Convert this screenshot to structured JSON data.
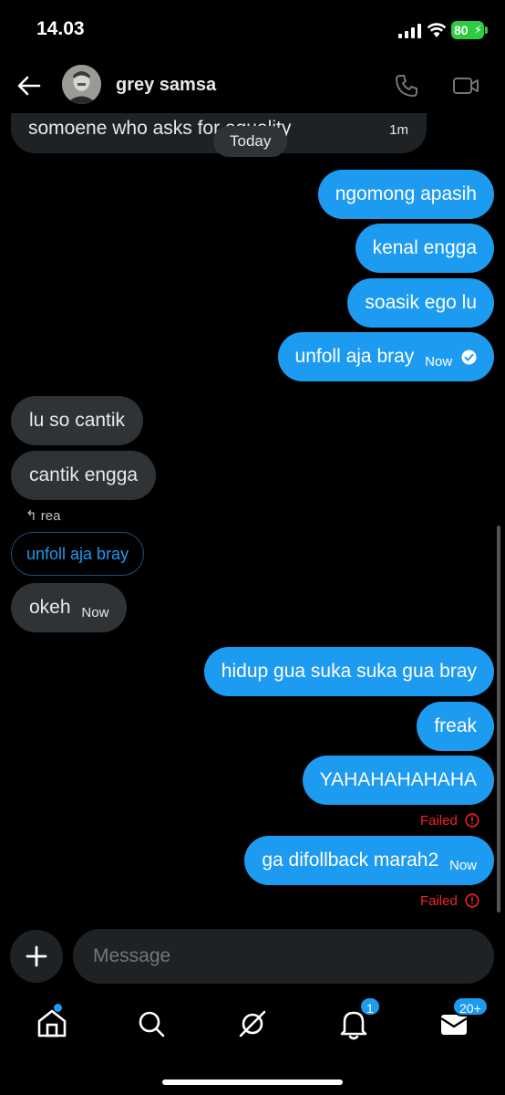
{
  "status": {
    "time": "14.03",
    "battery": "80"
  },
  "header": {
    "contact_name": "grey samsa"
  },
  "chat": {
    "top_message": {
      "text": "somoene who asks for equality",
      "time": "1m"
    },
    "date_divider": "Today",
    "messages": [
      {
        "dir": "out",
        "text": "ngomong apasih"
      },
      {
        "dir": "out",
        "text": "kenal engga"
      },
      {
        "dir": "out",
        "text": "soasik ego lu"
      },
      {
        "dir": "out",
        "text": "unfoll aja bray",
        "meta": "Now"
      },
      {
        "dir": "in",
        "text": "lu so cantik"
      },
      {
        "dir": "in",
        "text": "cantik engga"
      },
      {
        "dir": "in",
        "text": "okeh",
        "meta": "Now"
      },
      {
        "dir": "out",
        "text": "hidup gua suka suka gua bray"
      },
      {
        "dir": "out",
        "text": "freak"
      },
      {
        "dir": "out",
        "text": "YAHAHAHAHAHA"
      },
      {
        "dir": "out",
        "text": "ga difollback marah2",
        "meta": "Now"
      }
    ],
    "reply_context": {
      "author": "rea",
      "quoted_text": "unfoll aja bray"
    },
    "failed_label": "Failed"
  },
  "composer": {
    "placeholder": "Message"
  },
  "nav": {
    "items": [
      "home-icon",
      "search-icon",
      "grok-icon",
      "notifications-icon",
      "messages-icon"
    ],
    "notifications_badge": "1",
    "messages_badge": "20+"
  },
  "colors": {
    "accent": "#1d9bf0",
    "incoming_bubble": "#2f3336",
    "failed": "#f4212e",
    "battery": "#2ecc40"
  }
}
